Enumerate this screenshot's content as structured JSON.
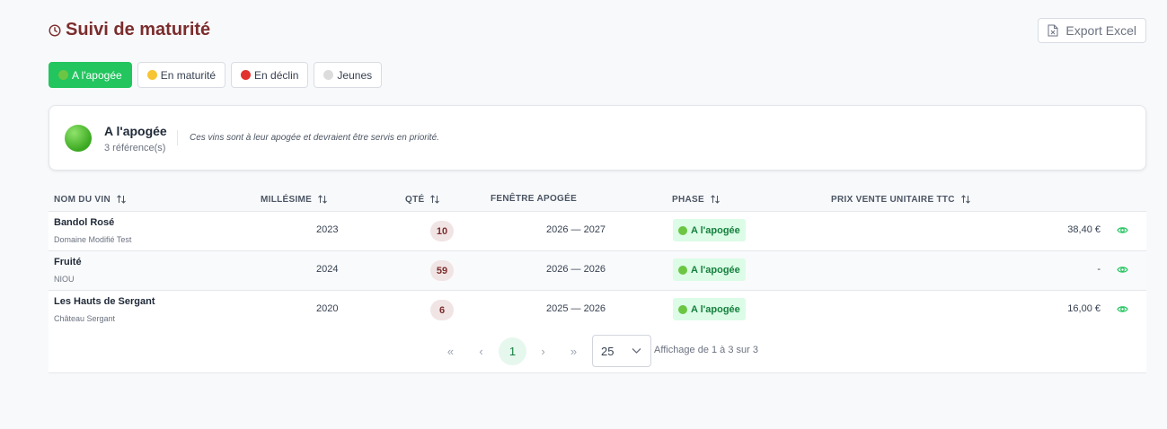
{
  "page": {
    "title": "Suivi de maturité"
  },
  "toolbar": {
    "export_label": "Export Excel"
  },
  "tabs": [
    {
      "label": "A l'apogée",
      "dot_color": "#6cc644",
      "active": true
    },
    {
      "label": "En maturité",
      "dot_color": "#f7c531",
      "active": false
    },
    {
      "label": "En déclin",
      "dot_color": "#e2322d",
      "active": false
    },
    {
      "label": "Jeunes",
      "dot_color": "#dcdcdc",
      "active": false
    }
  ],
  "card": {
    "title": "A l'apogée",
    "count": "3 référence(s)",
    "description": "Ces vins sont à leur apogée et devraient être servis en priorité."
  },
  "table": {
    "headers": {
      "name": "NOM DU VIN",
      "vintage": "MILLÉSIME",
      "qty": "QTÉ",
      "window": "FENÊTRE APOGÉE",
      "phase": "PHASE",
      "price": "PRIX VENTE UNITAIRE TTC"
    },
    "rows": [
      {
        "name": "Bandol Rosé",
        "producer": "Domaine Modifié Test",
        "vintage": "2023",
        "qty": "10",
        "window": "2026 — 2027",
        "phase": "A l'apogée",
        "price": "38,40 €"
      },
      {
        "name": "Fruité",
        "producer": "NIOU",
        "vintage": "2024",
        "qty": "59",
        "window": "2026 — 2026",
        "phase": "A l'apogée",
        "price": "-"
      },
      {
        "name": "Les Hauts de Sergant",
        "producer": "Château Sergant",
        "vintage": "2020",
        "qty": "6",
        "window": "2025 — 2026",
        "phase": "A l'apogée",
        "price": "16,00 €"
      }
    ]
  },
  "pagination": {
    "first": "«",
    "prev": "‹",
    "current_page": "1",
    "next": "›",
    "last": "»",
    "rows_per_page": "25",
    "info": "Affichage de 1 à 3 sur 3"
  },
  "colors": {
    "accent": "#22c55e",
    "title": "#7b2d2d",
    "phase_bg": "#dcfce7",
    "phase_text": "#15803d"
  }
}
